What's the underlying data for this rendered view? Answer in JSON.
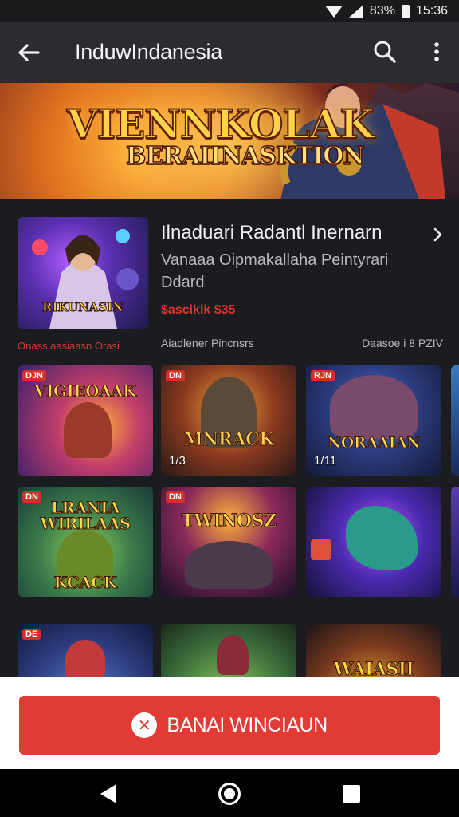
{
  "status": {
    "battery_text": "83%",
    "time": "15:36"
  },
  "app_bar": {
    "title": "InduwIndanesia",
    "back_icon": "arrow-left-icon",
    "search_icon": "search-icon",
    "more_icon": "more-vert-icon"
  },
  "hero": {
    "title": "VIENNKOLAK",
    "subtitle": "BERAIINASKTION"
  },
  "featured": {
    "thumb_caption": "RIKUNASIN",
    "title": "Ilnaduari Radantl Inernarn",
    "description": "Vanaaa Oipmakallaha Peintyrari Ddard",
    "price": "$ascikik $35"
  },
  "meta": {
    "left": "Onass aasiaasn Orasi",
    "middle": "Aiadlener Pincnsrs",
    "right": "Daasoe i 8 PZIV"
  },
  "tiles": [
    {
      "name": "VIGIEOAAK",
      "tag": "DJN",
      "count": ""
    },
    {
      "name": "MNRACK",
      "tag": "DN",
      "count": "1/3"
    },
    {
      "name": "NORAAIAN",
      "tag": "RJN",
      "count": "1/11"
    },
    {
      "name": "LRANIA WIRILAAS",
      "tag": "DN",
      "count": ""
    },
    {
      "name": "TWINOSZ",
      "tag": "DN",
      "count": ""
    },
    {
      "name": "",
      "tag": "",
      "count": ""
    },
    {
      "name": "",
      "tag": "DE",
      "count": ""
    },
    {
      "name": "",
      "tag": "",
      "count": ""
    },
    {
      "name": "WAIASII",
      "tag": "",
      "count": ""
    }
  ],
  "tile_extra": {
    "kcaak": "KCACK"
  },
  "cta": {
    "icon": "close-circle-icon",
    "label": "BANAI WINCIAUN"
  },
  "colors": {
    "accent": "#e23a34",
    "app_bar": "#2b2c30",
    "background": "#1b1c20"
  }
}
